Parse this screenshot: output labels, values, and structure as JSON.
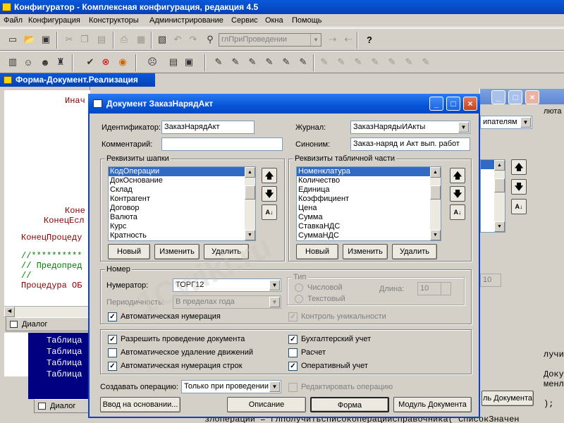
{
  "main": {
    "title": "Конфигуратор - Комплексная конфигурация, редакция 4.5",
    "menu": [
      "Файл",
      "Конфигурация",
      "Конструкторы",
      "Администрирование",
      "Сервис",
      "Окна",
      "Помощь"
    ],
    "toolbar_combo": "глПриПроведении"
  },
  "form_window": {
    "title": "Форма-Документ.Реализация",
    "code_lines": [
      {
        "text": "Инач",
        "color": "#8b0000"
      },
      {
        "text": "Коне",
        "color": "#8b0000"
      },
      {
        "text": "КонецЕсл",
        "color": "#8b0000"
      },
      {
        "text": "КонецПроцеду",
        "color": "#8b0000"
      },
      {
        "text": "//**********",
        "color": "#008000"
      },
      {
        "text": "// Предопред",
        "color": "#008000"
      },
      {
        "text": "//",
        "color": "#008000"
      },
      {
        "text": "Процедура ОБ",
        "color": "#8b0000"
      }
    ],
    "tab_dialog": "Диалог"
  },
  "bg_lower": {
    "code_lines": [
      "Таблица",
      "Таблица",
      "Таблица",
      "Таблица"
    ],
    "tab_dialog": "Диалог"
  },
  "bg_right": {
    "combo_value": "ипателям",
    "partial_text": "люта",
    "button_doc_module": "ль Документа",
    "spin_value": "10",
    "code_right": [
      "лучи",
      "Доку",
      "менл",
      ");",
      "(\"СписокЗначен"
    ],
    "bottom_code": "злоперации = глполучитьсписокоперацийсправочника(\"СписокЗначен"
  },
  "dialog": {
    "title": "Документ ЗаказНарядАкт",
    "identifier_label": "Идентификатор:",
    "identifier_value": "ЗаказНарядАкт",
    "comment_label": "Комментарий:",
    "comment_value": "",
    "journal_label": "Журнал:",
    "journal_value": "ЗаказНарядыИАкты",
    "synonym_label": "Синоним:",
    "synonym_value": "Заказ-наряд и Акт вып. работ",
    "header_attrs": {
      "label": "Реквизиты шапки",
      "items": [
        "КодОперации",
        "ДокОснование",
        "Склад",
        "Контрагент",
        "Договор",
        "Валюта",
        "Курс",
        "Кратность"
      ],
      "selected": 0
    },
    "table_attrs": {
      "label": "Реквизиты табличной части",
      "items": [
        "Номенклатура",
        "Количество",
        "Единица",
        "Коэффициент",
        "Цена",
        "Сумма",
        "СтавкаНДС",
        "СуммаНДС"
      ],
      "selected": 0
    },
    "list_buttons": {
      "new": "Новый",
      "edit": "Изменить",
      "delete": "Удалить"
    },
    "number_group": {
      "label": "Номер",
      "numerator_label": "Нумератор:",
      "numerator_value": "ТОРГ12",
      "periodicity_label": "Периодичность:",
      "periodicity_value": "В пределах года",
      "auto_number": "Автоматическая нумерация",
      "type_label": "Тип",
      "type_numeric": "Числовой",
      "type_text": "Текстовый",
      "length_label": "Длина:",
      "length_value": "10",
      "uniqueness": "Контроль уникальности"
    },
    "checks": {
      "allow_posting": "Разрешить проведение документа",
      "auto_delete": "Автоматическое удаление движений",
      "auto_number_rows": "Автоматическая нумерация строк",
      "accounting": "Бухгалтерский учет",
      "calculation": "Расчет",
      "operational": "Оперативный учет"
    },
    "create_op_label": "Создавать операцию:",
    "create_op_value": "Только при проведении",
    "edit_op": "Редактировать операцию",
    "buttons": {
      "enter_basis": "Ввод на основании...",
      "description": "Описание",
      "form": "Форма",
      "module": "Модуль Документа"
    },
    "watermark": "1Cwiki.ru"
  }
}
